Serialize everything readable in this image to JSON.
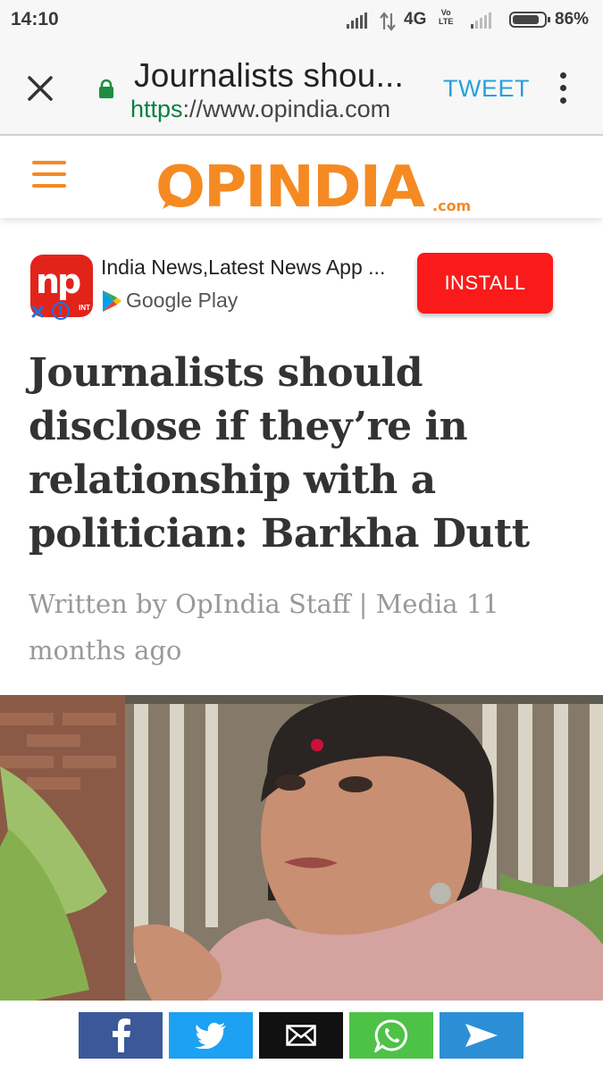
{
  "status_bar": {
    "time": "14:10",
    "network": "4G",
    "volte_line1": "Vo",
    "volte_line2": "LTE",
    "battery_level": 0.86,
    "battery_percent": "86%"
  },
  "custom_tab": {
    "title": "Journalists shou...",
    "url_scheme": "https",
    "url_rest": "://www.opindia.com",
    "tweet_label": "TWEET",
    "icons": [
      "close-icon",
      "lock-icon",
      "more-vert-icon"
    ],
    "lock_color": "#1e8e3e"
  },
  "site": {
    "logo_text": "OPINDIA",
    "logo_suffix": ".com",
    "brand_color": "#f58a23"
  },
  "ad": {
    "app_icon_text": "np",
    "app_icon_tag": "INT",
    "title": "India News,Latest News App ...",
    "store_label": "Google Play",
    "close_label": "✕",
    "info_label": "i",
    "install_label": "INSTALL",
    "install_color": "#fa1a1a"
  },
  "article": {
    "headline": "Journalists should disclose if they’re in relationship with a politician: Barkha Dutt",
    "byline": "Written by OpIndia Staff | Media 11 months ago"
  },
  "share_bar": {
    "buttons": [
      {
        "name": "facebook",
        "icon": "facebook-icon",
        "color": "#3b5998"
      },
      {
        "name": "twitter",
        "icon": "twitter-icon",
        "color": "#1da1f2"
      },
      {
        "name": "email",
        "icon": "mail-icon",
        "color": "#111111"
      },
      {
        "name": "whatsapp",
        "icon": "whatsapp-icon",
        "color": "#4dc247"
      },
      {
        "name": "telegram",
        "icon": "send-icon",
        "color": "#2c8fd6"
      }
    ]
  }
}
